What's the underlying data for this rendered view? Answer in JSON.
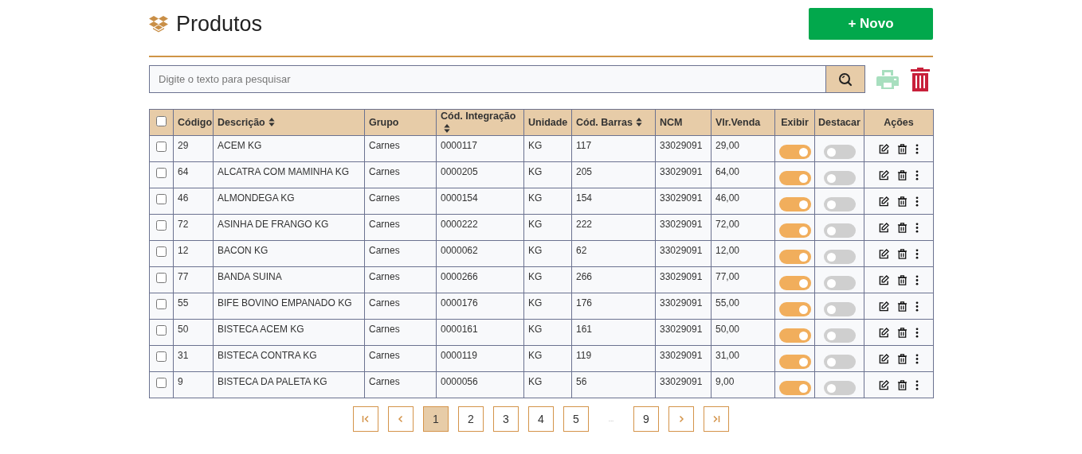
{
  "title": "Produtos",
  "new_button": "+ Novo",
  "search": {
    "placeholder": "Digite o texto para pesquisar"
  },
  "table": {
    "select_all": {
      "checked": false
    },
    "columns": [
      {
        "label": "Código",
        "sortable": false
      },
      {
        "label": "Descrição",
        "sortable": true
      },
      {
        "label": "Grupo",
        "sortable": false
      },
      {
        "label": "Cód. Integração",
        "sortable": true
      },
      {
        "label": "Unidade",
        "sortable": false
      },
      {
        "label": "Cód. Barras",
        "sortable": true
      },
      {
        "label": "NCM",
        "sortable": false
      },
      {
        "label": "Vlr.Venda",
        "sortable": false
      },
      {
        "label": "Exibir",
        "sortable": false
      },
      {
        "label": "Destacar",
        "sortable": false
      },
      {
        "label": "Ações",
        "sortable": false
      }
    ],
    "rows": [
      {
        "checked": false,
        "codigo": "29",
        "descricao": "ACEM KG",
        "grupo": "Carnes",
        "integracao": "0000117",
        "unidade": "KG",
        "barras": "117",
        "ncm": "33029091",
        "valor": "29,00",
        "exibir": true,
        "destacar": false
      },
      {
        "checked": false,
        "codigo": "64",
        "descricao": "ALCATRA COM MAMINHA KG",
        "grupo": "Carnes",
        "integracao": "0000205",
        "unidade": "KG",
        "barras": "205",
        "ncm": "33029091",
        "valor": "64,00",
        "exibir": true,
        "destacar": false
      },
      {
        "checked": false,
        "codigo": "46",
        "descricao": "ALMONDEGA KG",
        "grupo": "Carnes",
        "integracao": "0000154",
        "unidade": "KG",
        "barras": "154",
        "ncm": "33029091",
        "valor": "46,00",
        "exibir": true,
        "destacar": false
      },
      {
        "checked": false,
        "codigo": "72",
        "descricao": "ASINHA DE FRANGO KG",
        "grupo": "Carnes",
        "integracao": "0000222",
        "unidade": "KG",
        "barras": "222",
        "ncm": "33029091",
        "valor": "72,00",
        "exibir": true,
        "destacar": false
      },
      {
        "checked": false,
        "codigo": "12",
        "descricao": "BACON KG",
        "grupo": "Carnes",
        "integracao": "0000062",
        "unidade": "KG",
        "barras": "62",
        "ncm": "33029091",
        "valor": "12,00",
        "exibir": true,
        "destacar": false
      },
      {
        "checked": false,
        "codigo": "77",
        "descricao": "BANDA SUINA",
        "grupo": "Carnes",
        "integracao": "0000266",
        "unidade": "KG",
        "barras": "266",
        "ncm": "33029091",
        "valor": "77,00",
        "exibir": true,
        "destacar": false
      },
      {
        "checked": false,
        "codigo": "55",
        "descricao": "BIFE BOVINO EMPANADO KG",
        "grupo": "Carnes",
        "integracao": "0000176",
        "unidade": "KG",
        "barras": "176",
        "ncm": "33029091",
        "valor": "55,00",
        "exibir": true,
        "destacar": false
      },
      {
        "checked": false,
        "codigo": "50",
        "descricao": "BISTECA ACEM KG",
        "grupo": "Carnes",
        "integracao": "0000161",
        "unidade": "KG",
        "barras": "161",
        "ncm": "33029091",
        "valor": "50,00",
        "exibir": true,
        "destacar": false
      },
      {
        "checked": false,
        "codigo": "31",
        "descricao": "BISTECA CONTRA KG",
        "grupo": "Carnes",
        "integracao": "0000119",
        "unidade": "KG",
        "barras": "119",
        "ncm": "33029091",
        "valor": "31,00",
        "exibir": true,
        "destacar": false
      },
      {
        "checked": false,
        "codigo": "9",
        "descricao": "BISTECA DA PALETA KG",
        "grupo": "Carnes",
        "integracao": "0000056",
        "unidade": "KG",
        "barras": "56",
        "ncm": "33029091",
        "valor": "9,00",
        "exibir": true,
        "destacar": false
      }
    ]
  },
  "pagination": [
    {
      "kind": "first"
    },
    {
      "kind": "prev"
    },
    {
      "kind": "page",
      "label": "1",
      "selected": true
    },
    {
      "kind": "page",
      "label": "2",
      "selected": false
    },
    {
      "kind": "page",
      "label": "3",
      "selected": false
    },
    {
      "kind": "page",
      "label": "4",
      "selected": false
    },
    {
      "kind": "page",
      "label": "5",
      "selected": false
    },
    {
      "kind": "gap",
      "label": "..."
    },
    {
      "kind": "page",
      "label": "9",
      "selected": false
    },
    {
      "kind": "next"
    },
    {
      "kind": "last"
    }
  ]
}
